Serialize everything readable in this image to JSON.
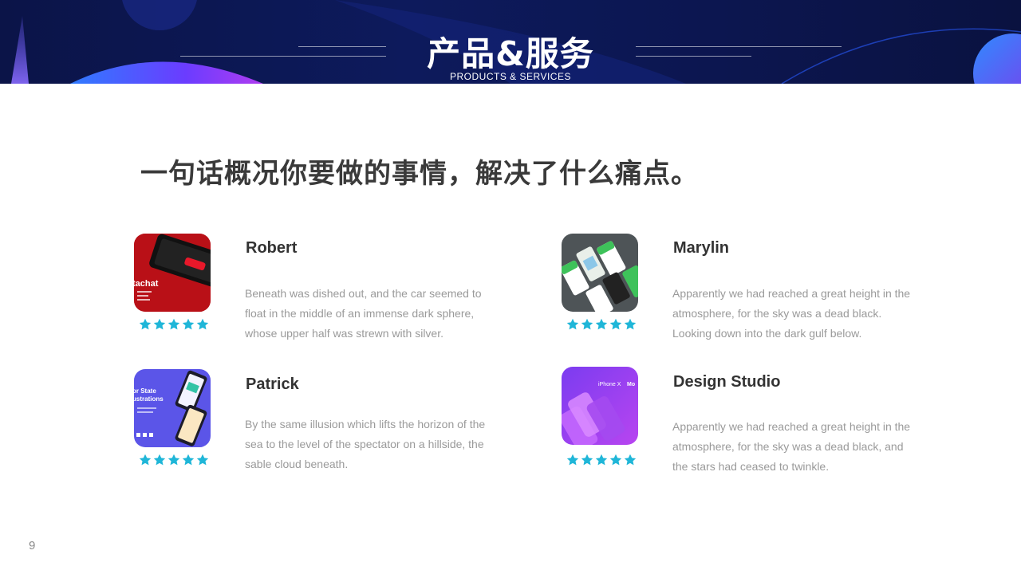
{
  "header": {
    "title": "产品&服务",
    "subtitle": "PRODUCTS & SERVICES"
  },
  "headline": "一句话概况你要做的事情，解决了什么痛点。",
  "colors": {
    "header_bg": "#0c1650",
    "accent_star": "#1fb6d8",
    "orb": "#3a5cff"
  },
  "cards": [
    {
      "name": "Robert",
      "desc": "Beneath was dished out, and the car seemed to float in the middle of an immense dark sphere, whose upper half was strewn with silver.",
      "rating": 5,
      "thumb_text": "tachat"
    },
    {
      "name": "Marylin",
      "desc": "Apparently we had reached a great height in the atmosphere, for the sky was a dead black. Looking down into the dark gulf below.",
      "rating": 5
    },
    {
      "name": "Patrick",
      "desc": "By the same illusion which lifts the horizon of the sea to the level of the spectator on a hillside, the sable cloud beneath.",
      "rating": 5,
      "thumb_text": "or State\nustrations"
    },
    {
      "name": "Design Studio",
      "desc": "Apparently we had reached a great height in the atmosphere, for the sky was a dead black, and the stars had ceased to twinkle.",
      "rating": 5,
      "thumb_text": "iPhone X Mo"
    }
  ],
  "page_number": "9"
}
